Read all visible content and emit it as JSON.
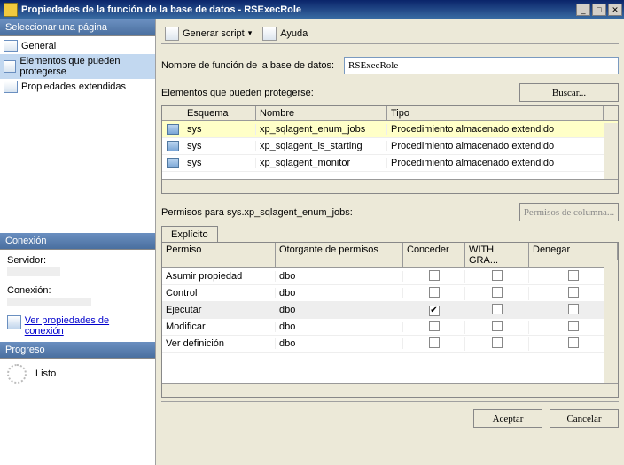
{
  "title": "Propiedades de la función de la base de datos - RSExecRole",
  "left": {
    "select_page": "Seleccionar una página",
    "pages": [
      "General",
      "Elementos que pueden protegerse",
      "Propiedades extendidas"
    ],
    "conn_hdr": "Conexión",
    "server_lbl": "Servidor:",
    "conn_lbl": "Conexión:",
    "view_props": "Ver propiedades de conexión",
    "prog_hdr": "Progreso",
    "prog_text": "Listo"
  },
  "toolbar": {
    "script": "Generar script",
    "help": "Ayuda"
  },
  "form": {
    "name_lbl": "Nombre de función de la base de datos:",
    "name_val": "RSExecRole",
    "securables_lbl": "Elementos que pueden protegerse:",
    "search_btn": "Buscar..."
  },
  "grid": {
    "headers": [
      "",
      "Esquema",
      "Nombre",
      "Tipo"
    ],
    "rows": [
      {
        "schema": "sys",
        "name": "xp_sqlagent_enum_jobs",
        "type": "Procedimiento almacenado extendido",
        "selected": true
      },
      {
        "schema": "sys",
        "name": "xp_sqlagent_is_starting",
        "type": "Procedimiento almacenado extendido",
        "selected": false
      },
      {
        "schema": "sys",
        "name": "xp_sqlagent_monitor",
        "type": "Procedimiento almacenado extendido",
        "selected": false
      }
    ]
  },
  "perm": {
    "label": "Permisos para sys.xp_sqlagent_enum_jobs:",
    "colperm_btn": "Permisos de columna...",
    "tab": "Explícito",
    "headers": [
      "Permiso",
      "Otorgante de permisos",
      "Conceder",
      "WITH GRA...",
      "Denegar"
    ],
    "rows": [
      {
        "perm": "Asumir propiedad",
        "grantor": "dbo",
        "grant": false,
        "withgrant": false,
        "deny": false,
        "selected": false
      },
      {
        "perm": "Control",
        "grantor": "dbo",
        "grant": false,
        "withgrant": false,
        "deny": false,
        "selected": false
      },
      {
        "perm": "Ejecutar",
        "grantor": "dbo",
        "grant": true,
        "withgrant": false,
        "deny": false,
        "selected": true
      },
      {
        "perm": "Modificar",
        "grantor": "dbo",
        "grant": false,
        "withgrant": false,
        "deny": false,
        "selected": false
      },
      {
        "perm": "Ver definición",
        "grantor": "dbo",
        "grant": false,
        "withgrant": false,
        "deny": false,
        "selected": false
      }
    ]
  },
  "footer": {
    "ok": "Aceptar",
    "cancel": "Cancelar"
  }
}
